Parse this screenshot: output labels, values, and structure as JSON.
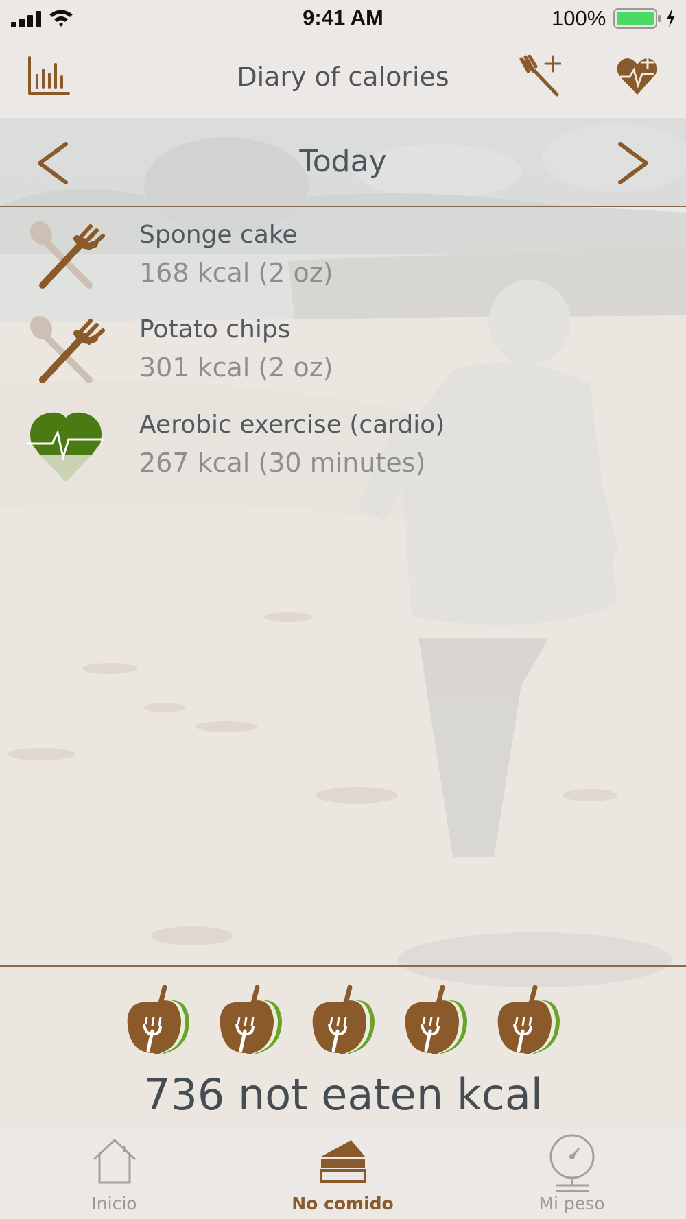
{
  "status_bar": {
    "time": "9:41 AM",
    "battery": "100%"
  },
  "nav": {
    "title": "Diary of calories",
    "left_icon": "bar-chart-icon",
    "right_icons": [
      "add-food-icon",
      "add-exercise-icon"
    ]
  },
  "date": {
    "label": "Today"
  },
  "entries": [
    {
      "name": "Sponge cake",
      "detail": "168 kcal (2 oz)",
      "icon": "food-icon"
    },
    {
      "name": "Potato chips",
      "detail": "301 kcal (2 oz)",
      "icon": "food-icon"
    },
    {
      "name": "Aerobic exercise (cardio)",
      "detail": "267 kcal (30 minutes)",
      "icon": "exercise-heart-icon"
    }
  ],
  "summary": {
    "apple_count": 5,
    "text": "736 not eaten kcal"
  },
  "tabs": [
    {
      "label": "Inicio",
      "icon": "home-icon",
      "active": false
    },
    {
      "label": "No comido",
      "icon": "cake-icon",
      "active": true
    },
    {
      "label": "Mi peso",
      "icon": "scale-icon",
      "active": false
    }
  ],
  "colors": {
    "brand_brown": "#8b5a2b",
    "exercise_green": "#4a7a12",
    "text_dark": "#4f555a",
    "text_muted": "#8d8f8f"
  }
}
